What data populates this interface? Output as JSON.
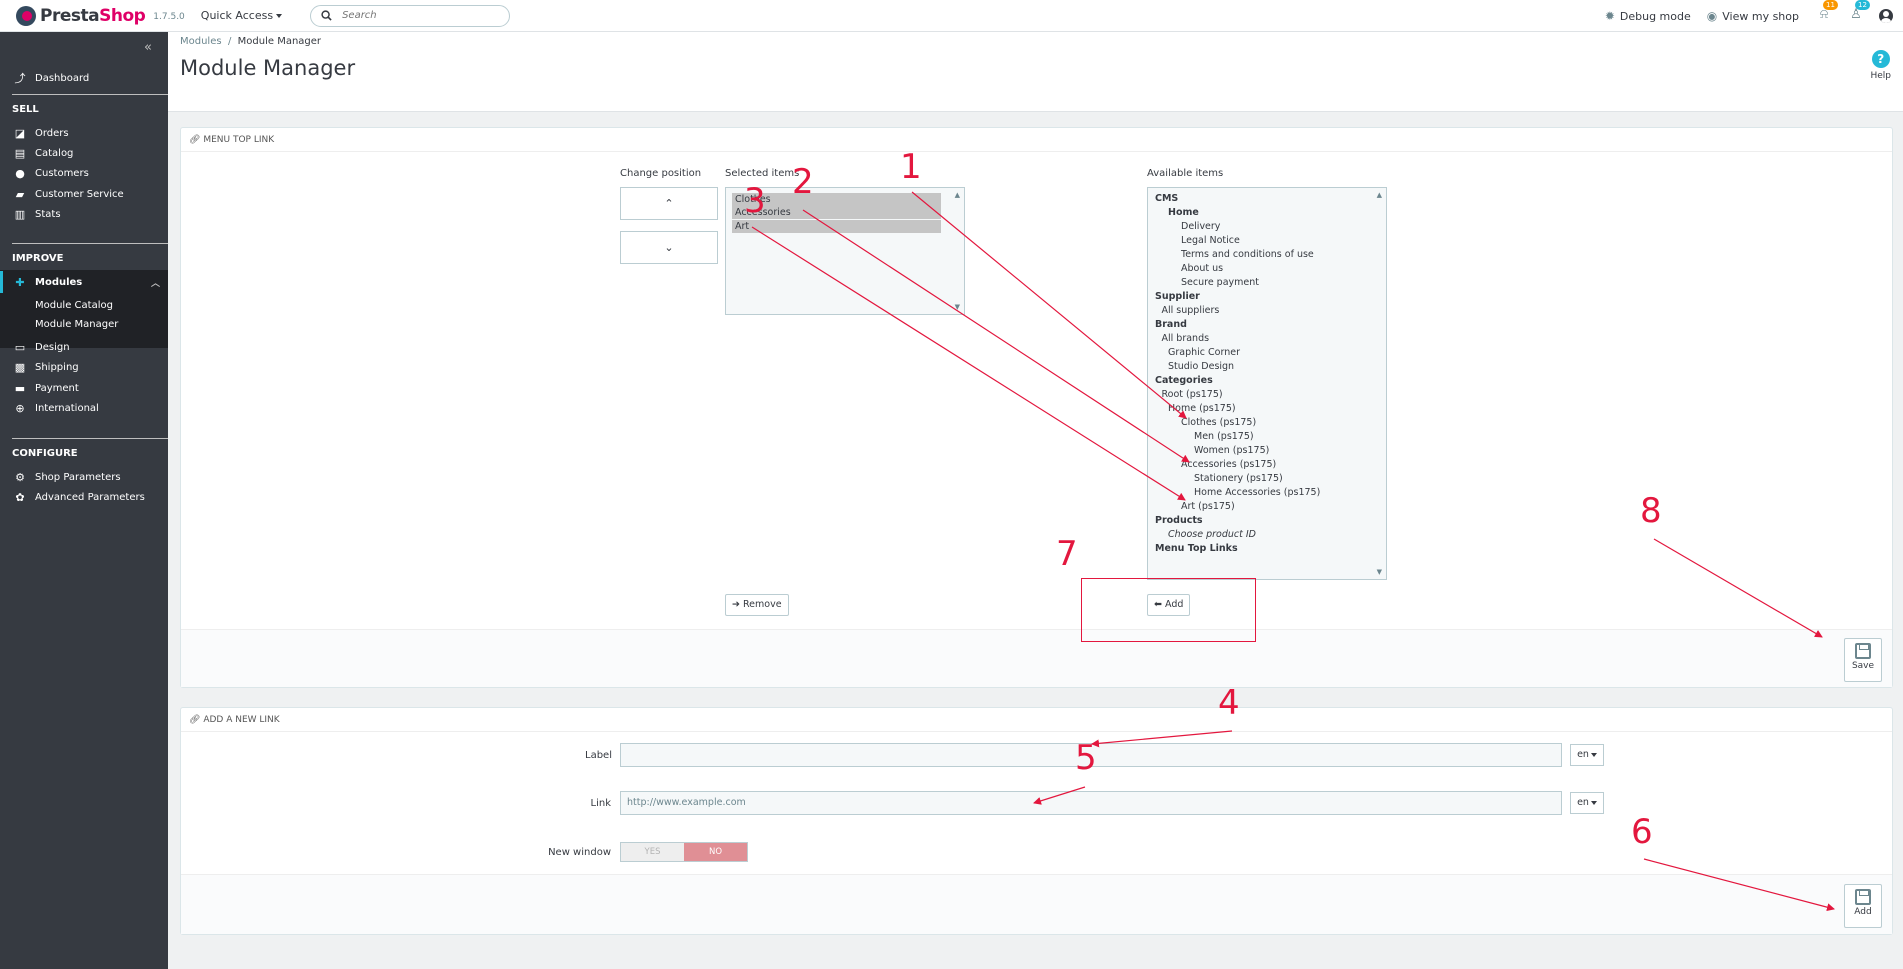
{
  "header": {
    "brand_pre": "Presta",
    "brand_post": "Shop",
    "version": "1.7.5.0",
    "quick_access": "Quick Access",
    "search_placeholder": "Search",
    "debug_mode": "Debug mode",
    "view_shop": "View my shop",
    "notif_orders": "11",
    "notif_customers": "12"
  },
  "sidebar": {
    "dashboard": "Dashboard",
    "sell": "SELL",
    "orders": "Orders",
    "catalog": "Catalog",
    "customers": "Customers",
    "customer_service": "Customer Service",
    "stats": "Stats",
    "improve": "IMPROVE",
    "modules": "Modules",
    "module_catalog": "Module Catalog",
    "module_manager": "Module Manager",
    "design": "Design",
    "shipping": "Shipping",
    "payment": "Payment",
    "international": "International",
    "configure": "CONFIGURE",
    "shop_parameters": "Shop Parameters",
    "advanced_parameters": "Advanced Parameters"
  },
  "page": {
    "breadcrumb_parent": "Modules",
    "breadcrumb_sep": "/",
    "breadcrumb_current": "Module Manager",
    "title": "Module Manager",
    "help": "Help"
  },
  "menu_panel": {
    "heading": "MENU TOP LINK",
    "change_position": "Change position",
    "selected_items": "Selected items",
    "available_items": "Available items",
    "selected": [
      "Clothes",
      "Accessories",
      "Art"
    ],
    "available": [
      {
        "text": "CMS",
        "level": 0,
        "style": "b"
      },
      {
        "text": "Home",
        "level": 1,
        "style": "b"
      },
      {
        "text": "Delivery",
        "level": 2,
        "style": ""
      },
      {
        "text": "Legal Notice",
        "level": 2,
        "style": ""
      },
      {
        "text": "Terms and conditions of use",
        "level": 2,
        "style": ""
      },
      {
        "text": "About us",
        "level": 2,
        "style": ""
      },
      {
        "text": "Secure payment",
        "level": 2,
        "style": ""
      },
      {
        "text": "Supplier",
        "level": 0,
        "style": "b"
      },
      {
        "text": "All suppliers",
        "level": 0.5,
        "style": ""
      },
      {
        "text": "Brand",
        "level": 0,
        "style": "b"
      },
      {
        "text": "All brands",
        "level": 0.5,
        "style": ""
      },
      {
        "text": "Graphic Corner",
        "level": 1,
        "style": ""
      },
      {
        "text": "Studio Design",
        "level": 1,
        "style": ""
      },
      {
        "text": "Categories",
        "level": 0,
        "style": "b"
      },
      {
        "text": "Root (ps175)",
        "level": 0.5,
        "style": ""
      },
      {
        "text": "Home (ps175)",
        "level": 1,
        "style": ""
      },
      {
        "text": "Clothes (ps175)",
        "level": 2,
        "style": ""
      },
      {
        "text": "Men (ps175)",
        "level": 3,
        "style": ""
      },
      {
        "text": "Women (ps175)",
        "level": 3,
        "style": ""
      },
      {
        "text": "Accessories (ps175)",
        "level": 2,
        "style": ""
      },
      {
        "text": "Stationery (ps175)",
        "level": 3,
        "style": ""
      },
      {
        "text": "Home Accessories (ps175)",
        "level": 3,
        "style": ""
      },
      {
        "text": "Art (ps175)",
        "level": 2,
        "style": ""
      },
      {
        "text": "Products",
        "level": 0,
        "style": "b"
      },
      {
        "text": "Choose product ID",
        "level": 1,
        "style": "i"
      },
      {
        "text": "Menu Top Links",
        "level": 0,
        "style": "b"
      }
    ],
    "remove": "Remove",
    "add": "Add",
    "save": "Save"
  },
  "link_panel": {
    "heading": "ADD A NEW LINK",
    "label_label": "Label",
    "label_value": "",
    "link_label": "Link",
    "link_placeholder": "http://www.example.com",
    "lang": "en",
    "new_window": "New window",
    "yes": "YES",
    "no": "NO",
    "add": "Add"
  },
  "annotations": [
    "1",
    "2",
    "3",
    "4",
    "5",
    "6",
    "7",
    "8"
  ],
  "colors": {
    "brand": "#df0067",
    "accent": "#25b9d7",
    "annotation": "#e3173e",
    "sidebar": "#363a41"
  }
}
